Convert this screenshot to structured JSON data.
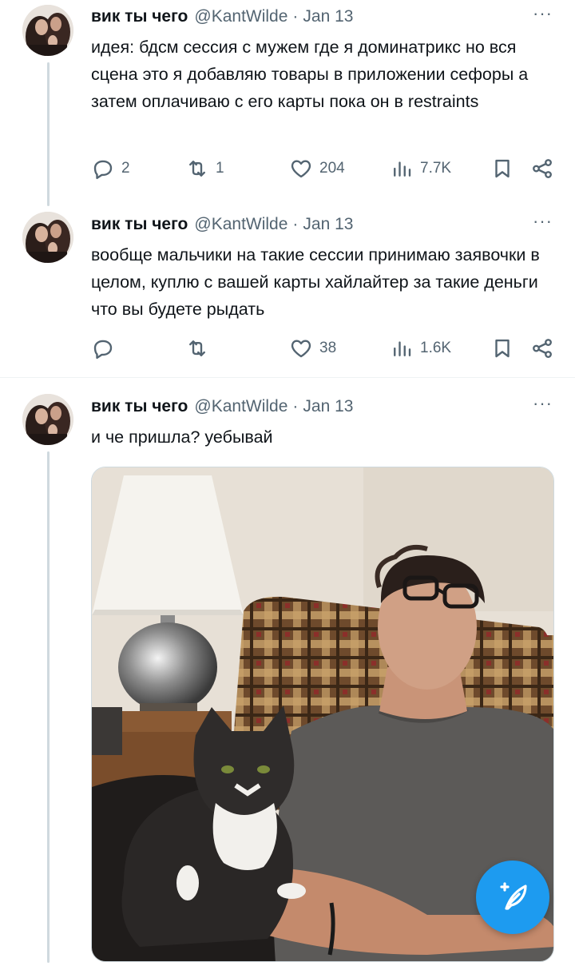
{
  "tweets": [
    {
      "name": "вик ты чего",
      "handle": "@KantWilde",
      "separator": "·",
      "date": "Jan 13",
      "more": "···",
      "text": "идея: бдсм сессия с мужем где я доминатрикс но вся сцена это я добавляю товары в приложении сефоры а затем оплачиваю с его карты пока он в restraints",
      "replies": "2",
      "retweets": "1",
      "likes": "204",
      "views": "7.7K"
    },
    {
      "name": "вик ты чего",
      "handle": "@KantWilde",
      "separator": "·",
      "date": "Jan 13",
      "more": "···",
      "text": "вообще мальчики на такие сессии принимаю заявочки в целом, куплю с вашей карты хайлайтер за такие деньги что вы будете рыдать",
      "replies": "",
      "retweets": "",
      "likes": "38",
      "views": "1.6K"
    },
    {
      "name": "вик ты чего",
      "handle": "@KantWilde",
      "separator": "·",
      "date": "Jan 13",
      "more": "···",
      "text": "и че пришла? уебывай"
    }
  ],
  "icons": {
    "reply": "reply-icon",
    "retweet": "retweet-icon",
    "like": "heart-icon",
    "views": "views-icon",
    "bookmark": "bookmark-icon",
    "share": "share-icon",
    "compose": "compose-icon"
  },
  "colors": {
    "accent": "#1d9bf0",
    "muted": "#536471",
    "text": "#0f1419",
    "thread_line": "#cfd9de"
  }
}
